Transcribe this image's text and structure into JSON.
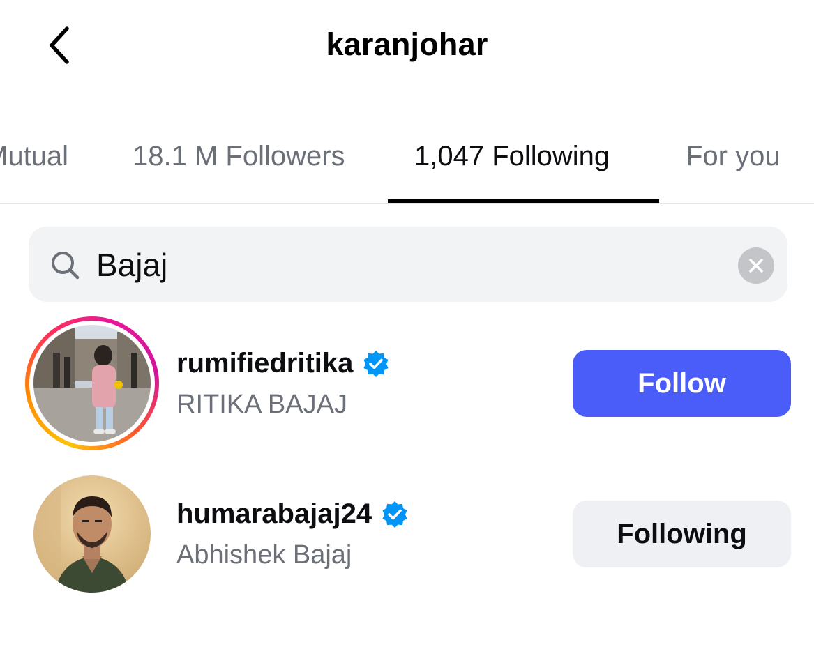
{
  "header": {
    "title": "karanjohar",
    "back_icon": "chevron-left-icon"
  },
  "tabs": [
    {
      "label": "Mutual",
      "active": false
    },
    {
      "label": "18.1 M Followers",
      "active": false
    },
    {
      "label": "1,047 Following",
      "active": true
    },
    {
      "label": "For you",
      "active": false
    }
  ],
  "search": {
    "value": "Bajaj",
    "search_icon": "magnifier-icon",
    "clear_icon": "clear-x-icon"
  },
  "results": [
    {
      "username": "rumifiedritika",
      "full_name": "RITIKA BAJAJ",
      "verified": true,
      "has_story": true,
      "button_label": "Follow"
    },
    {
      "username": "humarabajaj24",
      "full_name": "Abhishek Bajaj",
      "verified": true,
      "has_story": false,
      "button_label": "Following"
    }
  ],
  "colors": {
    "follow_button": "#4a5df9",
    "following_button": "#eff0f3",
    "verified_badge": "#0095f6",
    "secondary_text": "#6b6f78"
  }
}
